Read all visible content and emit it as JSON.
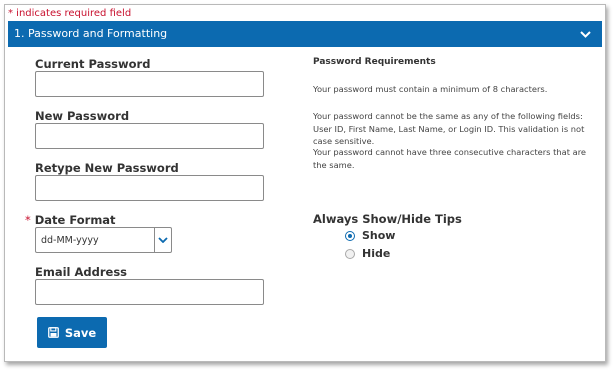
{
  "required_note": {
    "star": "*",
    "text": " indicates required field"
  },
  "section": {
    "title": "1. Password and Formatting",
    "icon": "chevron-down-icon"
  },
  "form": {
    "current_password_label": "Current Password",
    "new_password_label": "New Password",
    "retype_password_label": "Retype New Password",
    "date_format_star": "*",
    "date_format_label": "Date Format",
    "date_format_value": "dd-MM-yyyy",
    "email_label": "Email Address",
    "save_label": "Save"
  },
  "requirements": {
    "title": "Password Requirements",
    "items": [
      "Your password must contain a minimum of 8 characters.",
      "Your password cannot be the same as any of the following fields: User ID, First Name, Last Name, or Login ID. This validation is not case sensitive.",
      "Your password cannot have three consecutive characters that are the same."
    ]
  },
  "tips": {
    "title": "Always Show/Hide Tips",
    "options": [
      {
        "label": "Show",
        "selected": true
      },
      {
        "label": "Hide",
        "selected": false
      }
    ]
  },
  "colors": {
    "accent": "#0c6ab0",
    "required": "#c8102e"
  }
}
